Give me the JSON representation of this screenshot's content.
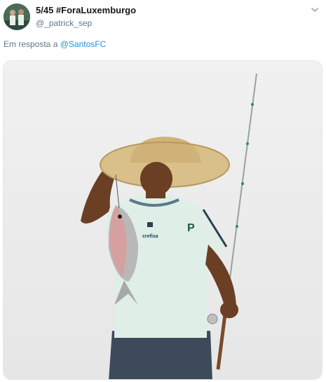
{
  "tweet": {
    "display_name": "5/45 #ForaLuxemburgo",
    "handle": "@_patrick_sep",
    "reply_prefix": "Em resposta a",
    "reply_to": "@SantosFC"
  },
  "colors": {
    "link": "#1b95e0",
    "secondary_text": "#657786",
    "border": "#e1e8ed"
  },
  "icons": {
    "menu": "chevron-down-icon"
  },
  "media": {
    "shirt_logo": "P",
    "shirt_sponsor": "crefisa"
  }
}
